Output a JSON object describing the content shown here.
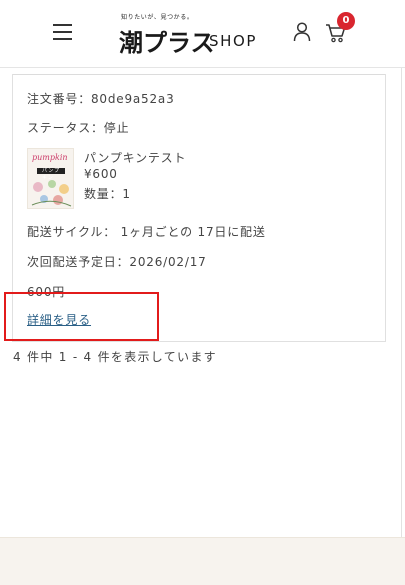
{
  "header": {
    "logo": {
      "tagline": "知りたいが、見つかる。",
      "main": "潮プラス",
      "shop": "SHOP"
    },
    "cart_count": "0",
    "colors": {
      "badge": "#d9262f"
    },
    "icons": [
      "hamburger-menu-icon",
      "user-icon",
      "cart-icon"
    ]
  },
  "order": {
    "order_number": "注文番号：80de9a52a3",
    "status": "ステータス：停止",
    "product": {
      "thumb_word": "pumpkin",
      "thumb_tag": "パンプキン",
      "name": "パンプキンテスト",
      "price": "¥600",
      "quantity": "数量：1"
    },
    "cycle": "配送サイクル： 1ヶ月ごとの 17日に配送",
    "next_delivery": "次回配送予定日：2026/02/17",
    "total": "600円",
    "detail_link": "詳細を見る"
  },
  "pagination": {
    "info": "4 件中 1 - 4 件を表示しています"
  }
}
